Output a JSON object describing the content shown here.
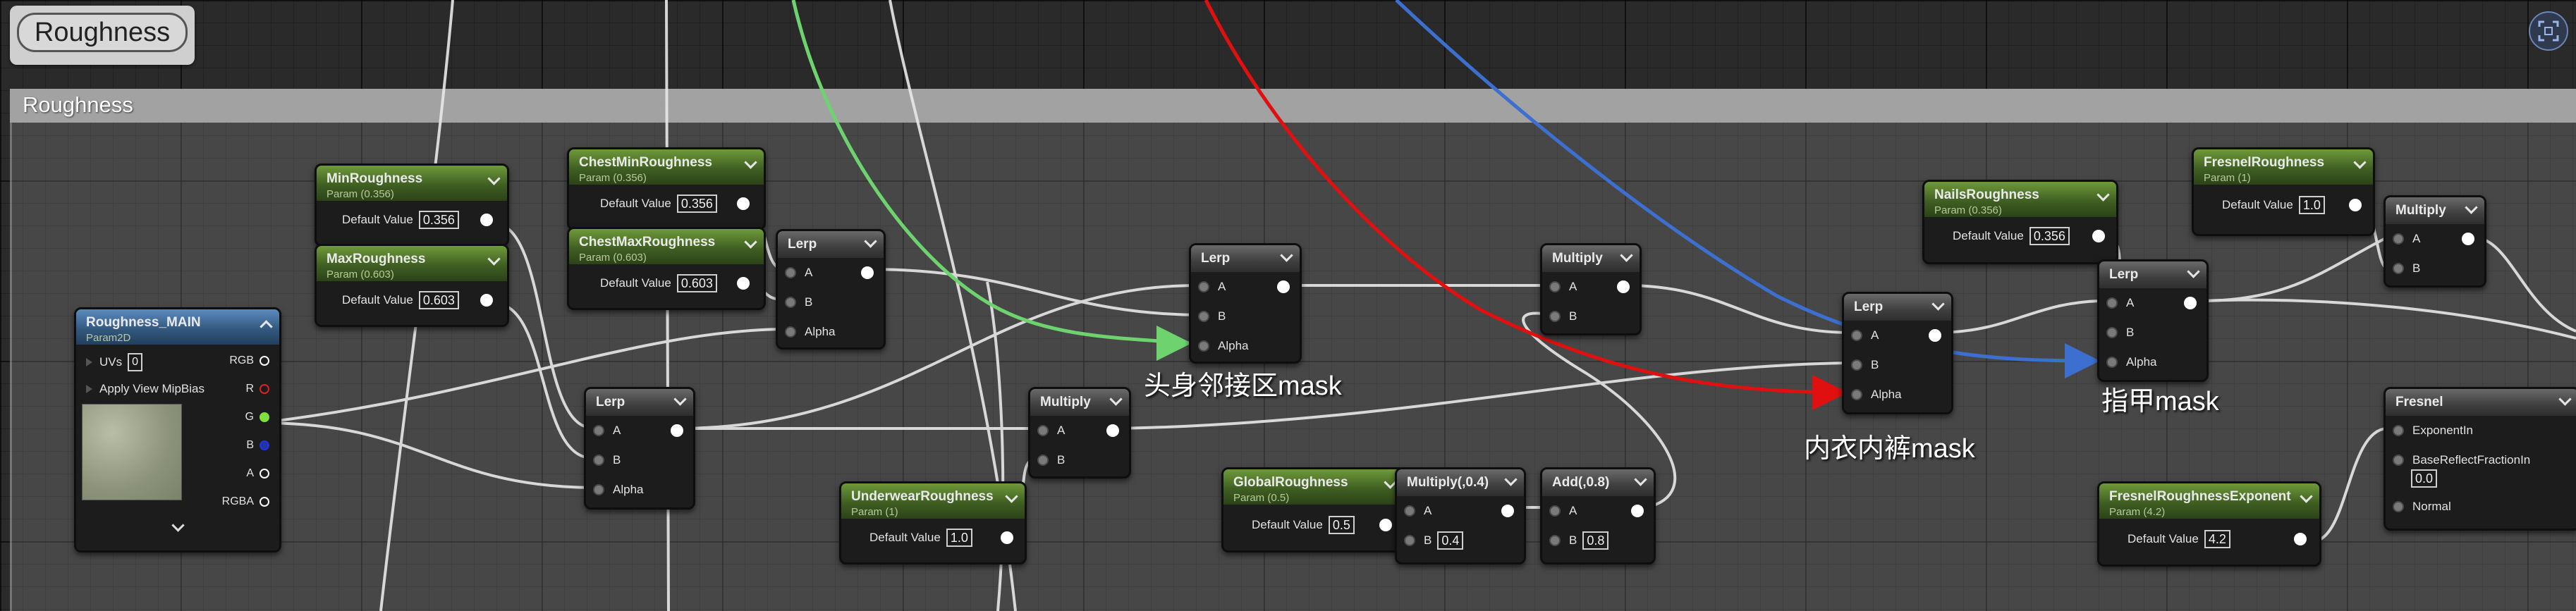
{
  "title_bubble": "Roughness",
  "comment_title": "Roughness",
  "colors": {
    "green_wire": "#6ed36e",
    "red_wire": "#e01010",
    "blue_wire": "#3c6fd0",
    "white_wire": "#e8e8e8"
  },
  "annotations": {
    "head_body": "头身邻接区mask",
    "underwear": "内衣内裤mask",
    "nails": "指甲mask"
  },
  "nodes": {
    "roughness_main": {
      "title": "Roughness_MAIN",
      "subtitle": "Param2D",
      "uvs_label": "UVs",
      "uvs_value": "0",
      "mip_label": "Apply View MipBias",
      "outputs": [
        "RGB",
        "R",
        "G",
        "B",
        "A",
        "RGBA"
      ]
    },
    "min_roughness": {
      "title": "MinRoughness",
      "subtitle": "Param (0.356)",
      "label": "Default Value",
      "value": "0.356"
    },
    "max_roughness": {
      "title": "MaxRoughness",
      "subtitle": "Param (0.603)",
      "label": "Default Value",
      "value": "0.603"
    },
    "chest_min": {
      "title": "ChestMinRoughness",
      "subtitle": "Param (0.356)",
      "label": "Default Value",
      "value": "0.356"
    },
    "chest_max": {
      "title": "ChestMaxRoughness",
      "subtitle": "Param (0.603)",
      "label": "Default Value",
      "value": "0.603"
    },
    "lerp1": {
      "title": "Lerp",
      "a": "A",
      "b": "B",
      "alpha": "Alpha"
    },
    "lerp2": {
      "title": "Lerp",
      "a": "A",
      "b": "B",
      "alpha": "Alpha"
    },
    "lerp3": {
      "title": "Lerp",
      "a": "A",
      "b": "B",
      "alpha": "Alpha"
    },
    "multiply1": {
      "title": "Multiply",
      "a": "A",
      "b": "B"
    },
    "underwear": {
      "title": "UnderwearRoughness",
      "subtitle": "Param (1)",
      "label": "Default Value",
      "value": "1.0"
    },
    "multiply2": {
      "title": "Multiply",
      "a": "A",
      "b": "B"
    },
    "global": {
      "title": "GlobalRoughness",
      "subtitle": "Param (0.5)",
      "label": "Default Value",
      "value": "0.5"
    },
    "multiply04": {
      "title": "Multiply(,0.4)",
      "a": "A",
      "b": "B",
      "b_value": "0.4"
    },
    "add08": {
      "title": "Add(,0.8)",
      "a": "A",
      "b": "B",
      "b_value": "0.8"
    },
    "lerp4": {
      "title": "Lerp",
      "a": "A",
      "b": "B",
      "alpha": "Alpha"
    },
    "nails": {
      "title": "NailsRoughness",
      "subtitle": "Param (0.356)",
      "label": "Default Value",
      "value": "0.356"
    },
    "lerp5": {
      "title": "Lerp",
      "a": "A",
      "b": "B",
      "alpha": "Alpha"
    },
    "fresnel_rough": {
      "title": "FresnelRoughness",
      "subtitle": "Param (1)",
      "label": "Default Value",
      "value": "1.0"
    },
    "multiply3": {
      "title": "Multiply",
      "a": "A",
      "b": "B"
    },
    "fresnel": {
      "title": "Fresnel",
      "exp": "ExponentIn",
      "base": "BaseReflectFractionIn",
      "base_value": "0.0",
      "normal": "Normal"
    },
    "fresnel_exp": {
      "title": "FresnelRoughnessExponent",
      "subtitle": "Param (4.2)",
      "label": "Default Value",
      "value": "4.2"
    }
  }
}
